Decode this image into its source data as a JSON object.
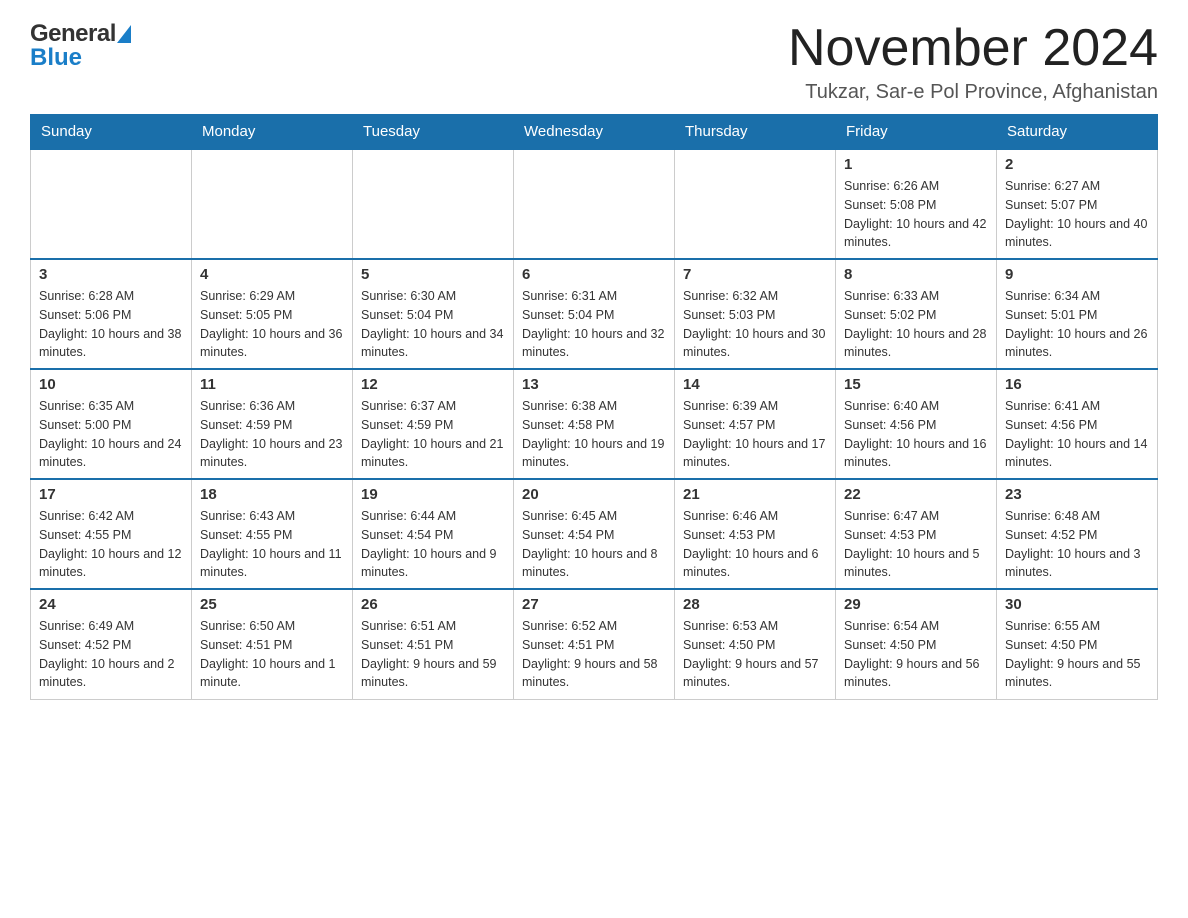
{
  "logo": {
    "general_text": "General",
    "blue_text": "Blue"
  },
  "header": {
    "month_year": "November 2024",
    "location": "Tukzar, Sar-e Pol Province, Afghanistan"
  },
  "days_of_week": [
    "Sunday",
    "Monday",
    "Tuesday",
    "Wednesday",
    "Thursday",
    "Friday",
    "Saturday"
  ],
  "weeks": [
    {
      "days": [
        {
          "number": "",
          "info": ""
        },
        {
          "number": "",
          "info": ""
        },
        {
          "number": "",
          "info": ""
        },
        {
          "number": "",
          "info": ""
        },
        {
          "number": "",
          "info": ""
        },
        {
          "number": "1",
          "info": "Sunrise: 6:26 AM\nSunset: 5:08 PM\nDaylight: 10 hours and 42 minutes."
        },
        {
          "number": "2",
          "info": "Sunrise: 6:27 AM\nSunset: 5:07 PM\nDaylight: 10 hours and 40 minutes."
        }
      ]
    },
    {
      "days": [
        {
          "number": "3",
          "info": "Sunrise: 6:28 AM\nSunset: 5:06 PM\nDaylight: 10 hours and 38 minutes."
        },
        {
          "number": "4",
          "info": "Sunrise: 6:29 AM\nSunset: 5:05 PM\nDaylight: 10 hours and 36 minutes."
        },
        {
          "number": "5",
          "info": "Sunrise: 6:30 AM\nSunset: 5:04 PM\nDaylight: 10 hours and 34 minutes."
        },
        {
          "number": "6",
          "info": "Sunrise: 6:31 AM\nSunset: 5:04 PM\nDaylight: 10 hours and 32 minutes."
        },
        {
          "number": "7",
          "info": "Sunrise: 6:32 AM\nSunset: 5:03 PM\nDaylight: 10 hours and 30 minutes."
        },
        {
          "number": "8",
          "info": "Sunrise: 6:33 AM\nSunset: 5:02 PM\nDaylight: 10 hours and 28 minutes."
        },
        {
          "number": "9",
          "info": "Sunrise: 6:34 AM\nSunset: 5:01 PM\nDaylight: 10 hours and 26 minutes."
        }
      ]
    },
    {
      "days": [
        {
          "number": "10",
          "info": "Sunrise: 6:35 AM\nSunset: 5:00 PM\nDaylight: 10 hours and 24 minutes."
        },
        {
          "number": "11",
          "info": "Sunrise: 6:36 AM\nSunset: 4:59 PM\nDaylight: 10 hours and 23 minutes."
        },
        {
          "number": "12",
          "info": "Sunrise: 6:37 AM\nSunset: 4:59 PM\nDaylight: 10 hours and 21 minutes."
        },
        {
          "number": "13",
          "info": "Sunrise: 6:38 AM\nSunset: 4:58 PM\nDaylight: 10 hours and 19 minutes."
        },
        {
          "number": "14",
          "info": "Sunrise: 6:39 AM\nSunset: 4:57 PM\nDaylight: 10 hours and 17 minutes."
        },
        {
          "number": "15",
          "info": "Sunrise: 6:40 AM\nSunset: 4:56 PM\nDaylight: 10 hours and 16 minutes."
        },
        {
          "number": "16",
          "info": "Sunrise: 6:41 AM\nSunset: 4:56 PM\nDaylight: 10 hours and 14 minutes."
        }
      ]
    },
    {
      "days": [
        {
          "number": "17",
          "info": "Sunrise: 6:42 AM\nSunset: 4:55 PM\nDaylight: 10 hours and 12 minutes."
        },
        {
          "number": "18",
          "info": "Sunrise: 6:43 AM\nSunset: 4:55 PM\nDaylight: 10 hours and 11 minutes."
        },
        {
          "number": "19",
          "info": "Sunrise: 6:44 AM\nSunset: 4:54 PM\nDaylight: 10 hours and 9 minutes."
        },
        {
          "number": "20",
          "info": "Sunrise: 6:45 AM\nSunset: 4:54 PM\nDaylight: 10 hours and 8 minutes."
        },
        {
          "number": "21",
          "info": "Sunrise: 6:46 AM\nSunset: 4:53 PM\nDaylight: 10 hours and 6 minutes."
        },
        {
          "number": "22",
          "info": "Sunrise: 6:47 AM\nSunset: 4:53 PM\nDaylight: 10 hours and 5 minutes."
        },
        {
          "number": "23",
          "info": "Sunrise: 6:48 AM\nSunset: 4:52 PM\nDaylight: 10 hours and 3 minutes."
        }
      ]
    },
    {
      "days": [
        {
          "number": "24",
          "info": "Sunrise: 6:49 AM\nSunset: 4:52 PM\nDaylight: 10 hours and 2 minutes."
        },
        {
          "number": "25",
          "info": "Sunrise: 6:50 AM\nSunset: 4:51 PM\nDaylight: 10 hours and 1 minute."
        },
        {
          "number": "26",
          "info": "Sunrise: 6:51 AM\nSunset: 4:51 PM\nDaylight: 9 hours and 59 minutes."
        },
        {
          "number": "27",
          "info": "Sunrise: 6:52 AM\nSunset: 4:51 PM\nDaylight: 9 hours and 58 minutes."
        },
        {
          "number": "28",
          "info": "Sunrise: 6:53 AM\nSunset: 4:50 PM\nDaylight: 9 hours and 57 minutes."
        },
        {
          "number": "29",
          "info": "Sunrise: 6:54 AM\nSunset: 4:50 PM\nDaylight: 9 hours and 56 minutes."
        },
        {
          "number": "30",
          "info": "Sunrise: 6:55 AM\nSunset: 4:50 PM\nDaylight: 9 hours and 55 minutes."
        }
      ]
    }
  ]
}
